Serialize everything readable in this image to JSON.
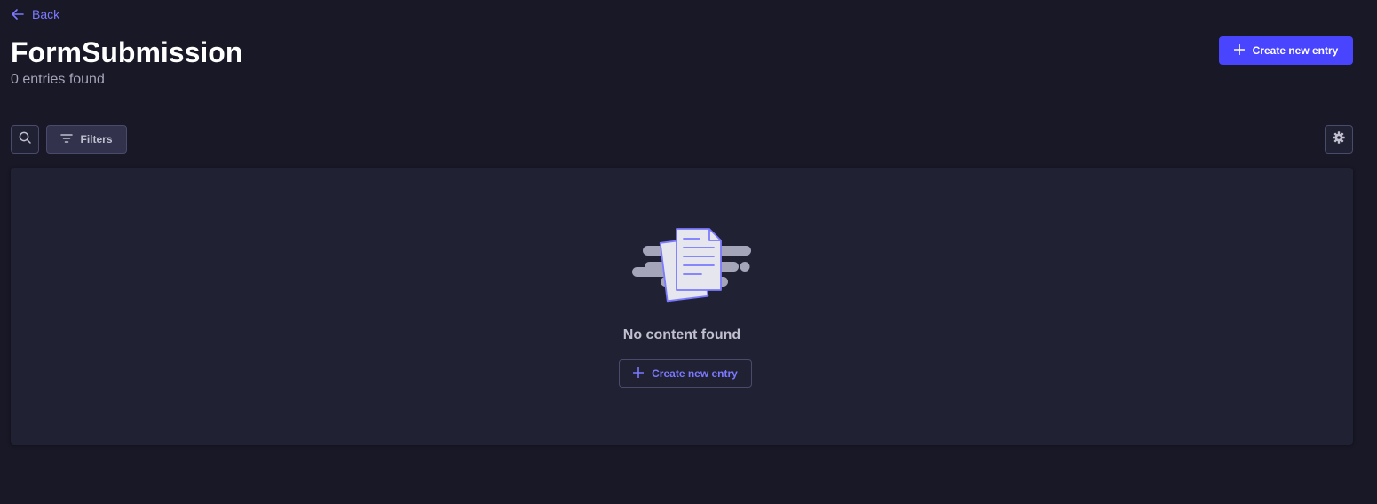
{
  "header": {
    "back_label": "Back",
    "title": "FormSubmission",
    "entries_count": "0 entries found",
    "create_button_label": "Create new entry"
  },
  "toolbar": {
    "filters_label": "Filters"
  },
  "empty_state": {
    "message": "No content found",
    "create_button_label": "Create new entry"
  },
  "icons": {
    "back": "arrow-left-icon",
    "plus": "plus-icon",
    "search": "search-icon",
    "filter": "filter-icon",
    "settings": "gear-icon",
    "empty": "documents-illustration"
  },
  "colors": {
    "accent": "#4945ff",
    "accent_text": "#7b79ff",
    "background": "#181826",
    "panel": "#212134"
  }
}
